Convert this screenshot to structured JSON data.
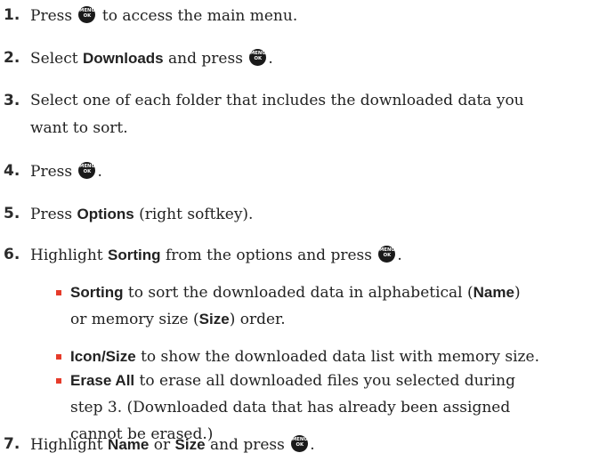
{
  "steps": [
    {
      "num": "1.",
      "t1": "Press ",
      "t2": " to access the main menu."
    },
    {
      "num": "2.",
      "t1": "Select ",
      "b1": "Downloads",
      "t2": " and press ",
      "t3": "."
    },
    {
      "num": "3.",
      "line1": "Select one of each folder that includes the downloaded data you",
      "line2": "want to sort."
    },
    {
      "num": "4.",
      "t1": "Press ",
      "t2": "."
    },
    {
      "num": "5.",
      "t1": "Press ",
      "b1": "Options",
      "t2": " (right softkey)."
    },
    {
      "num": "6.",
      "t1": "Highlight ",
      "b1": "Sorting",
      "t2": " from the options and press ",
      "t3": "."
    },
    {
      "num": "7.",
      "t1": "Highlight ",
      "b1": "Name",
      "t2": " or ",
      "b2": "Size",
      "t3": " and press ",
      "t4": "."
    }
  ],
  "bullets": [
    {
      "b1": "Sorting",
      "t1": " to sort the downloaded data in alphabetical (",
      "b2": "Name",
      "t2": ")",
      "line2a": "or memory size (",
      "line2b": "Size",
      "line2c": ") order."
    },
    {
      "b1": "Icon/Size",
      "t1": " to show the downloaded data list with memory size."
    },
    {
      "b1": "Erase All",
      "t1": " to erase all downloaded files you selected during",
      "line2": "step 3. (Downloaded data that has already been assigned",
      "line3": "cannot be erased.)"
    }
  ],
  "icon_name": "menu-ok-key-icon",
  "colors": {
    "bullet": "#e63b2a",
    "text": "#222222",
    "icon": "#1a1a1a"
  }
}
